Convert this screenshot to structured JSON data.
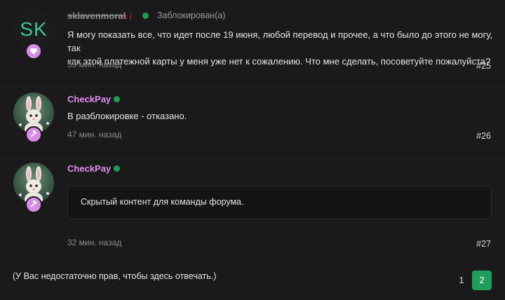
{
  "posts": [
    {
      "avatar_text": "SK",
      "username": "sklavenmoral",
      "status": "Заблокирован(а)",
      "message_line1": "Я могу показать все, что идет после 19 июня, любой перевод и прочее, а что было до этого не могу, так",
      "message_line2": "как этой платежной карты у меня уже нет к сожалению. Что мне сделать, посоветуйте пожалуйста?",
      "time": "53 мин. назад",
      "number": "#25",
      "badge_icon": "heart-icon",
      "name_icon": "devil-horns-icon"
    },
    {
      "username": "CheckPay",
      "message": "В разблокировке - отказано.",
      "time": "47 мин. назад",
      "number": "#26",
      "badge_icon": "gavel-icon"
    },
    {
      "username": "CheckPay",
      "hidden_content": "Скрытый контент для команды форума.",
      "time": "32 мин. назад",
      "number": "#27",
      "badge_icon": "gavel-icon"
    }
  ],
  "footer": {
    "notice": "(У Вас недостаточно прав, чтобы здесь отвечать.)",
    "pages": [
      "1",
      "2"
    ],
    "current_page": "2"
  },
  "colors": {
    "background": "#1a1a1a",
    "online": "#1f9d55",
    "checkpay_name": "#e38cf0",
    "badge": "#d98be8",
    "page_active": "#1e9e5e",
    "avatar_text": "#3fc392"
  }
}
